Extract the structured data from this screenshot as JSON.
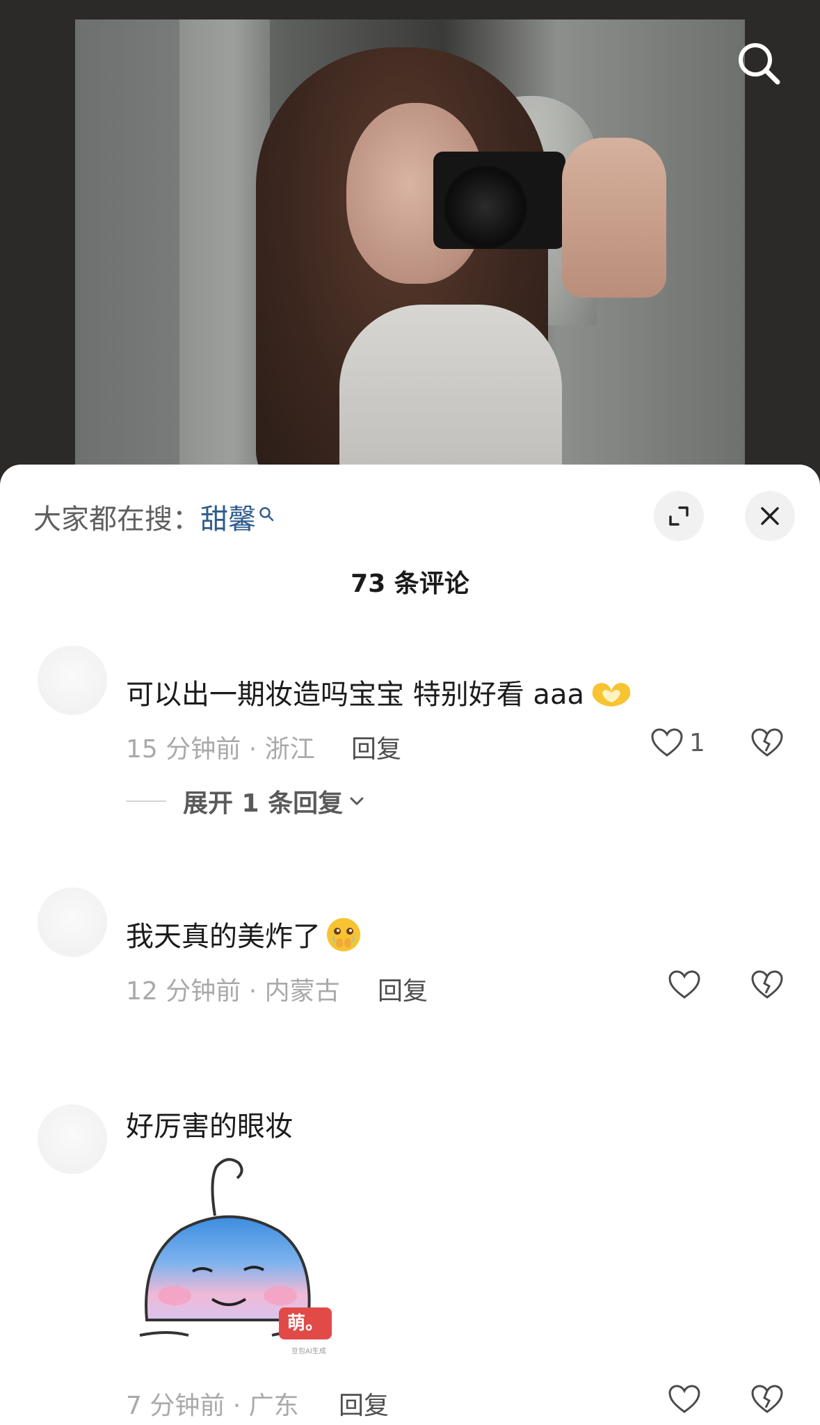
{
  "top_bar": {
    "search_icon": "search-icon"
  },
  "sheet": {
    "hot_search_label": "大家都在搜：",
    "hot_search_keyword": "甜馨",
    "expand_icon": "expand-icon",
    "close_icon": "close-icon",
    "comment_count_title": "73 条评论"
  },
  "comments": [
    {
      "text": "可以出一期妆造吗宝宝 特别好看 aaa",
      "emoji": "heart-hands-emoji",
      "time_location": "15 分钟前 · 浙江",
      "reply_label": "回复",
      "like_count": "1",
      "expand_replies_label": "展开 1 条回复"
    },
    {
      "text": "我天真的美炸了",
      "emoji": "holding-back-tears-emoji",
      "time_location": "12 分钟前 · 内蒙古",
      "reply_label": "回复",
      "like_count": ""
    },
    {
      "text": "好厉害的眼妆",
      "sticker": {
        "tag": "萌。",
        "tag_sub": "豆包AI生成"
      },
      "time_location": "7 分钟前 · 广东",
      "reply_label": "回复",
      "like_count": ""
    }
  ],
  "colors": {
    "keyword": "#2f5b8d",
    "meta": "#a9a9a9",
    "sheet_bg": "#ffffff"
  }
}
